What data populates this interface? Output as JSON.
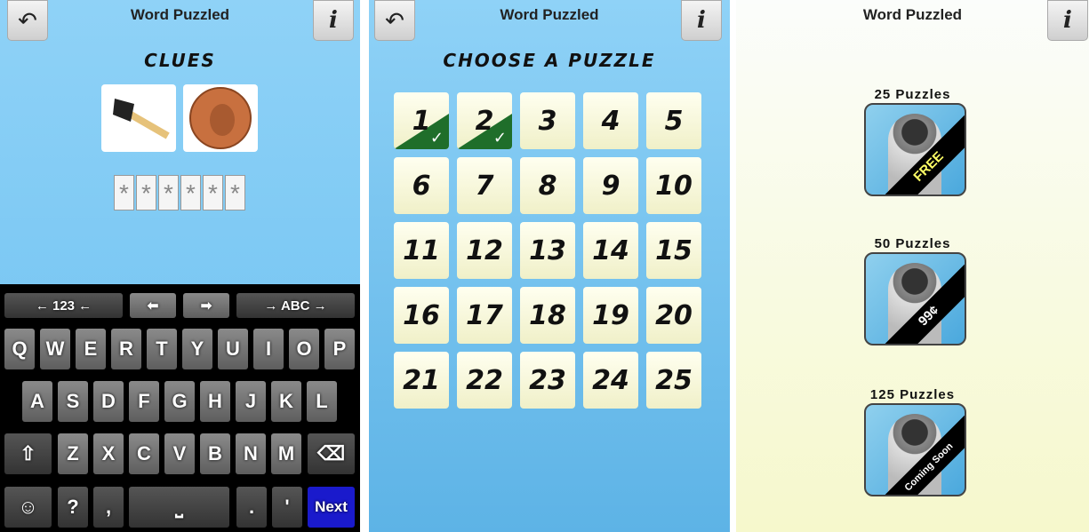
{
  "app_title": "Word Puzzled",
  "icons": {
    "back": "undo-arrow-icon",
    "info": "info-icon"
  },
  "clues_screen": {
    "heading": "CLUES",
    "clue_images": [
      "axe-icon",
      "penny-coin-icon"
    ],
    "answer": [
      "*",
      "*",
      "*",
      "*",
      "*",
      "*"
    ],
    "keyboard": {
      "top_row": [
        "← 123 ←",
        "→ ABC →"
      ],
      "row1": [
        "Q",
        "W",
        "E",
        "R",
        "T",
        "Y",
        "U",
        "I",
        "O",
        "P"
      ],
      "row2": [
        "A",
        "S",
        "D",
        "F",
        "G",
        "H",
        "J",
        "K",
        "L"
      ],
      "row3": [
        "Z",
        "X",
        "C",
        "V",
        "B",
        "N",
        "M"
      ],
      "row4": {
        "emoji": "☺",
        "question": "?",
        "comma": ",",
        "period": ".",
        "apostrophe": "'",
        "next": "Next"
      }
    }
  },
  "puzzle_screen": {
    "heading": "CHOOSE A PUZZLE",
    "puzzles": [
      "1",
      "2",
      "3",
      "4",
      "5",
      "6",
      "7",
      "8",
      "9",
      "10",
      "11",
      "12",
      "13",
      "14",
      "15",
      "16",
      "17",
      "18",
      "19",
      "20",
      "21",
      "22",
      "23",
      "24",
      "25"
    ],
    "completed": [
      "1",
      "2"
    ],
    "completed_color": "#1f6e2a"
  },
  "packs_screen": {
    "packs": [
      {
        "label": "25 Puzzles",
        "badge": "FREE"
      },
      {
        "label": "50 Puzzles",
        "badge": "99¢"
      },
      {
        "label": "125 Puzzles",
        "badge": "Coming Soon"
      }
    ]
  }
}
